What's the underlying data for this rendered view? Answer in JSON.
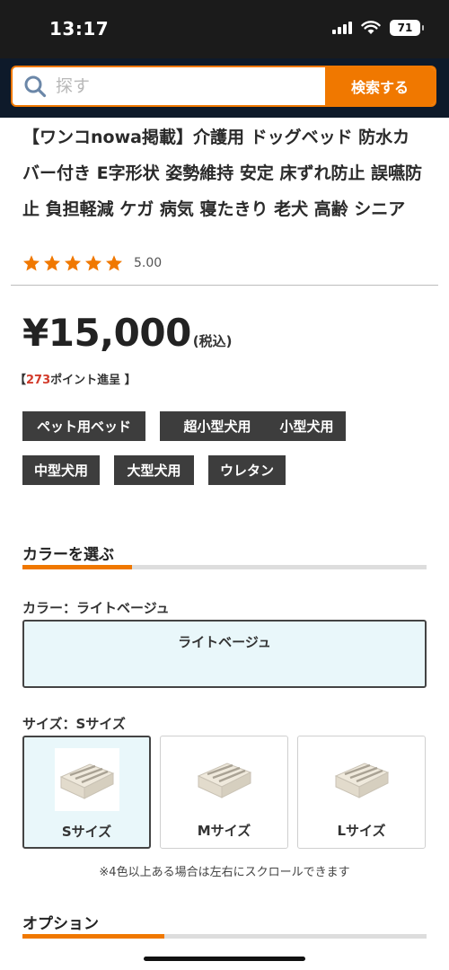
{
  "status_bar": {
    "time": "13:17",
    "battery": "71"
  },
  "search": {
    "placeholder": "探す",
    "button_label": "検索する"
  },
  "product": {
    "title": "【ワンコnowa掲載】介護用 ドッグベッド 防水カバー付き E字形状 姿勢維持 安定 床ずれ防止 誤嚥防止 負担軽減 ケガ 病気 寝たきり 老犬 高齢 シニア",
    "rating": 5,
    "rating_text": "5.00",
    "price": "¥15,000",
    "tax_note": "(税込)",
    "points_prefix": "【",
    "points_value": "273",
    "points_suffix": "ポイント進呈 】",
    "tags": [
      "ペット用ベッド",
      "超小型犬用",
      "小型犬用",
      "中型犬用",
      "大型犬用",
      "ウレタン"
    ]
  },
  "color_section": {
    "heading": "カラーを選ぶ",
    "progress": 0.27,
    "label": "カラー：ライトベージュ",
    "options": [
      "ライトベージュ"
    ],
    "selected_index": 0
  },
  "size_section": {
    "label": "サイズ：Sサイズ",
    "options": [
      "Sサイズ",
      "Mサイズ",
      "Lサイズ"
    ],
    "selected_index": 0,
    "note": "※4色以上ある場合は左右にスクロールできます"
  },
  "option_section": {
    "heading": "オプション",
    "progress": 0.35
  },
  "colors": {
    "accent": "#f07800",
    "header_bg": "#0e1a2a",
    "tag_bg": "#3d3d3d",
    "selected_bg": "#e9f7fa",
    "point_red": "#d23a2a"
  }
}
